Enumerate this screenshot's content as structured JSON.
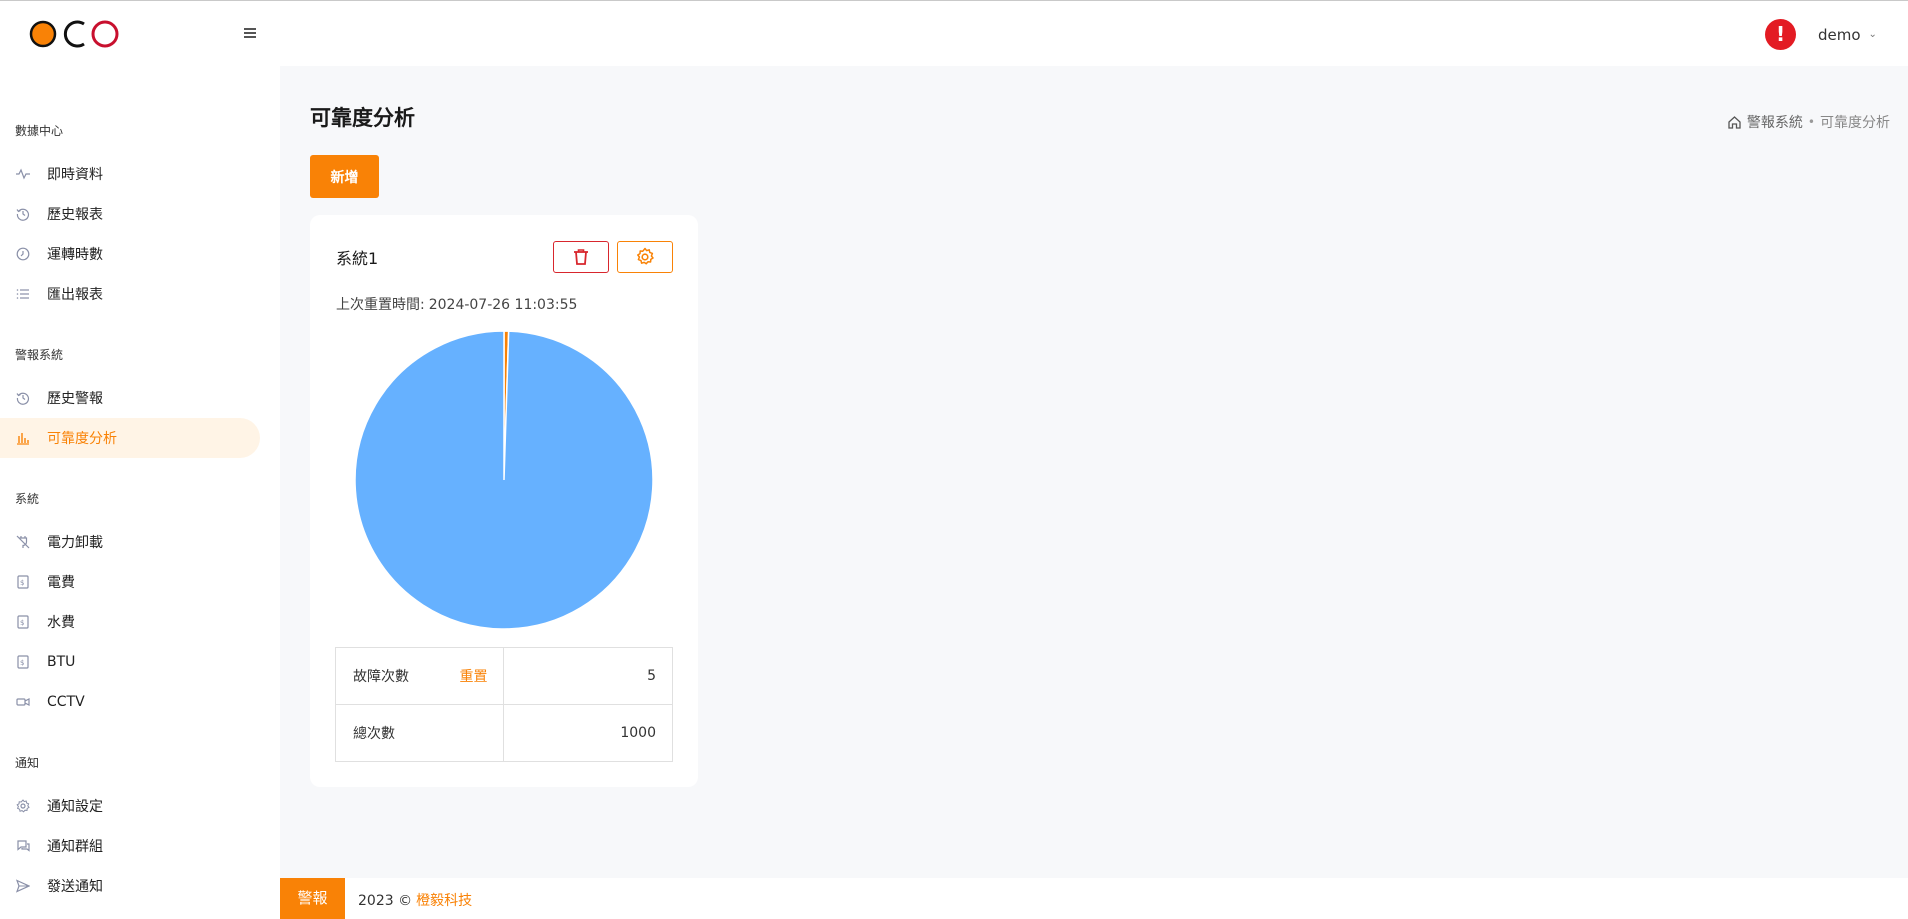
{
  "header": {
    "user_name": "demo",
    "alert_symbol": "!"
  },
  "sidebar": {
    "groups": [
      {
        "title": "數據中心",
        "items": [
          {
            "label": "即時資料",
            "icon": "activity-icon"
          },
          {
            "label": "歷史報表",
            "icon": "history-icon"
          },
          {
            "label": "運轉時數",
            "icon": "clock-icon"
          },
          {
            "label": "匯出報表",
            "icon": "list-icon"
          }
        ]
      },
      {
        "title": "警報系統",
        "items": [
          {
            "label": "歷史警報",
            "icon": "history-icon"
          },
          {
            "label": "可靠度分析",
            "icon": "bar-chart-icon",
            "active": true
          }
        ]
      },
      {
        "title": "系統",
        "items": [
          {
            "label": "電力卸載",
            "icon": "unplug-icon"
          },
          {
            "label": "電費",
            "icon": "bill-icon"
          },
          {
            "label": "水費",
            "icon": "bill-icon"
          },
          {
            "label": "BTU",
            "icon": "bill-icon"
          },
          {
            "label": "CCTV",
            "icon": "video-icon"
          }
        ]
      },
      {
        "title": "通知",
        "items": [
          {
            "label": "通知設定",
            "icon": "gear-icon"
          },
          {
            "label": "通知群組",
            "icon": "chat-icon"
          },
          {
            "label": "發送通知",
            "icon": "send-icon"
          }
        ]
      }
    ]
  },
  "main": {
    "page_title": "可靠度分析",
    "breadcrumb": [
      "警報系統",
      "可靠度分析"
    ],
    "add_button": "新增",
    "card": {
      "title": "系統1",
      "reset_time_label": "上次重置時間:",
      "reset_time_value": "2024-07-26 11:03:55",
      "failure_label": "故障次數",
      "reset_link": "重置",
      "failure_count": "5",
      "total_label": "總次數",
      "total_count": "1000"
    }
  },
  "chart_data": {
    "type": "pie",
    "slices": [
      {
        "value": 5,
        "color": "#f98206"
      },
      {
        "value": 995,
        "color": "#66b1ff"
      }
    ]
  },
  "footer": {
    "alert_tab": "警報",
    "copyright": "2023 ©",
    "company": "橙毅科技"
  },
  "colors": {
    "accent": "#f98206",
    "danger": "#d8262d",
    "pie_main": "#66b1ff"
  }
}
